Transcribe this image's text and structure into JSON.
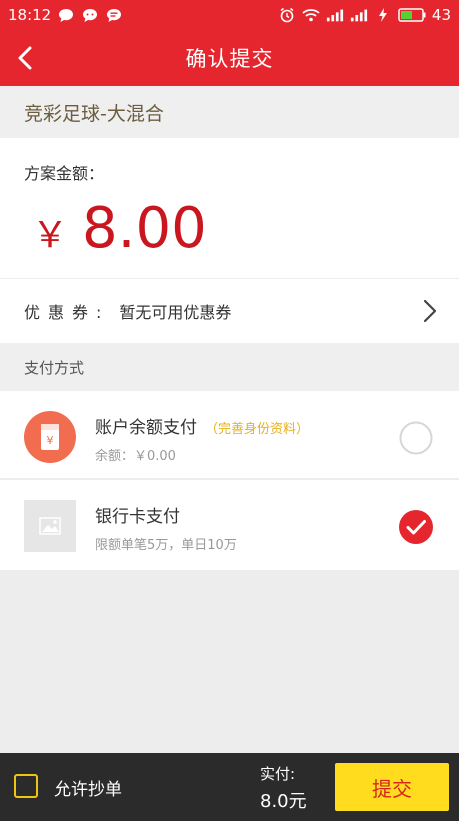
{
  "status_bar": {
    "time": "18:12",
    "battery": "43",
    "left_icons": [
      "chat-bubble-icon",
      "messenger-icon",
      "message-icon"
    ],
    "right_icons": [
      "alarm-icon",
      "wifi-icon",
      "signal-icon",
      "signal-icon",
      "charging-icon",
      "battery-icon"
    ]
  },
  "header": {
    "title": "确认提交",
    "back_icon": "back-chevron-icon"
  },
  "lottery_type": "竞彩足球-大混合",
  "amount": {
    "label": "方案金额：",
    "currency": "￥",
    "value": "8.00"
  },
  "coupon": {
    "label": "优惠券:",
    "value": "暂无可用优惠券"
  },
  "payment": {
    "section_title": "支付方式",
    "methods": [
      {
        "title": "账户余额支付",
        "note": "（完善身份资料）",
        "sub": "余额：￥0.00",
        "selected": false,
        "icon": "wallet-icon"
      },
      {
        "title": "银行卡支付",
        "note": "",
        "sub": "限额单笔5万，单日10万",
        "selected": true,
        "icon": "image-placeholder-icon"
      }
    ]
  },
  "bottom": {
    "allow_copy_label": "允许抄单",
    "paid_label": "实付:",
    "paid_value": "8.0元",
    "submit_label": "提交"
  },
  "colors": {
    "primary_red": "#e5262e",
    "amount_red": "#c9161f",
    "note_yellow": "#e4b01e",
    "submit_yellow": "#ffdc1e",
    "bottom_dark": "#2b2b2b"
  }
}
